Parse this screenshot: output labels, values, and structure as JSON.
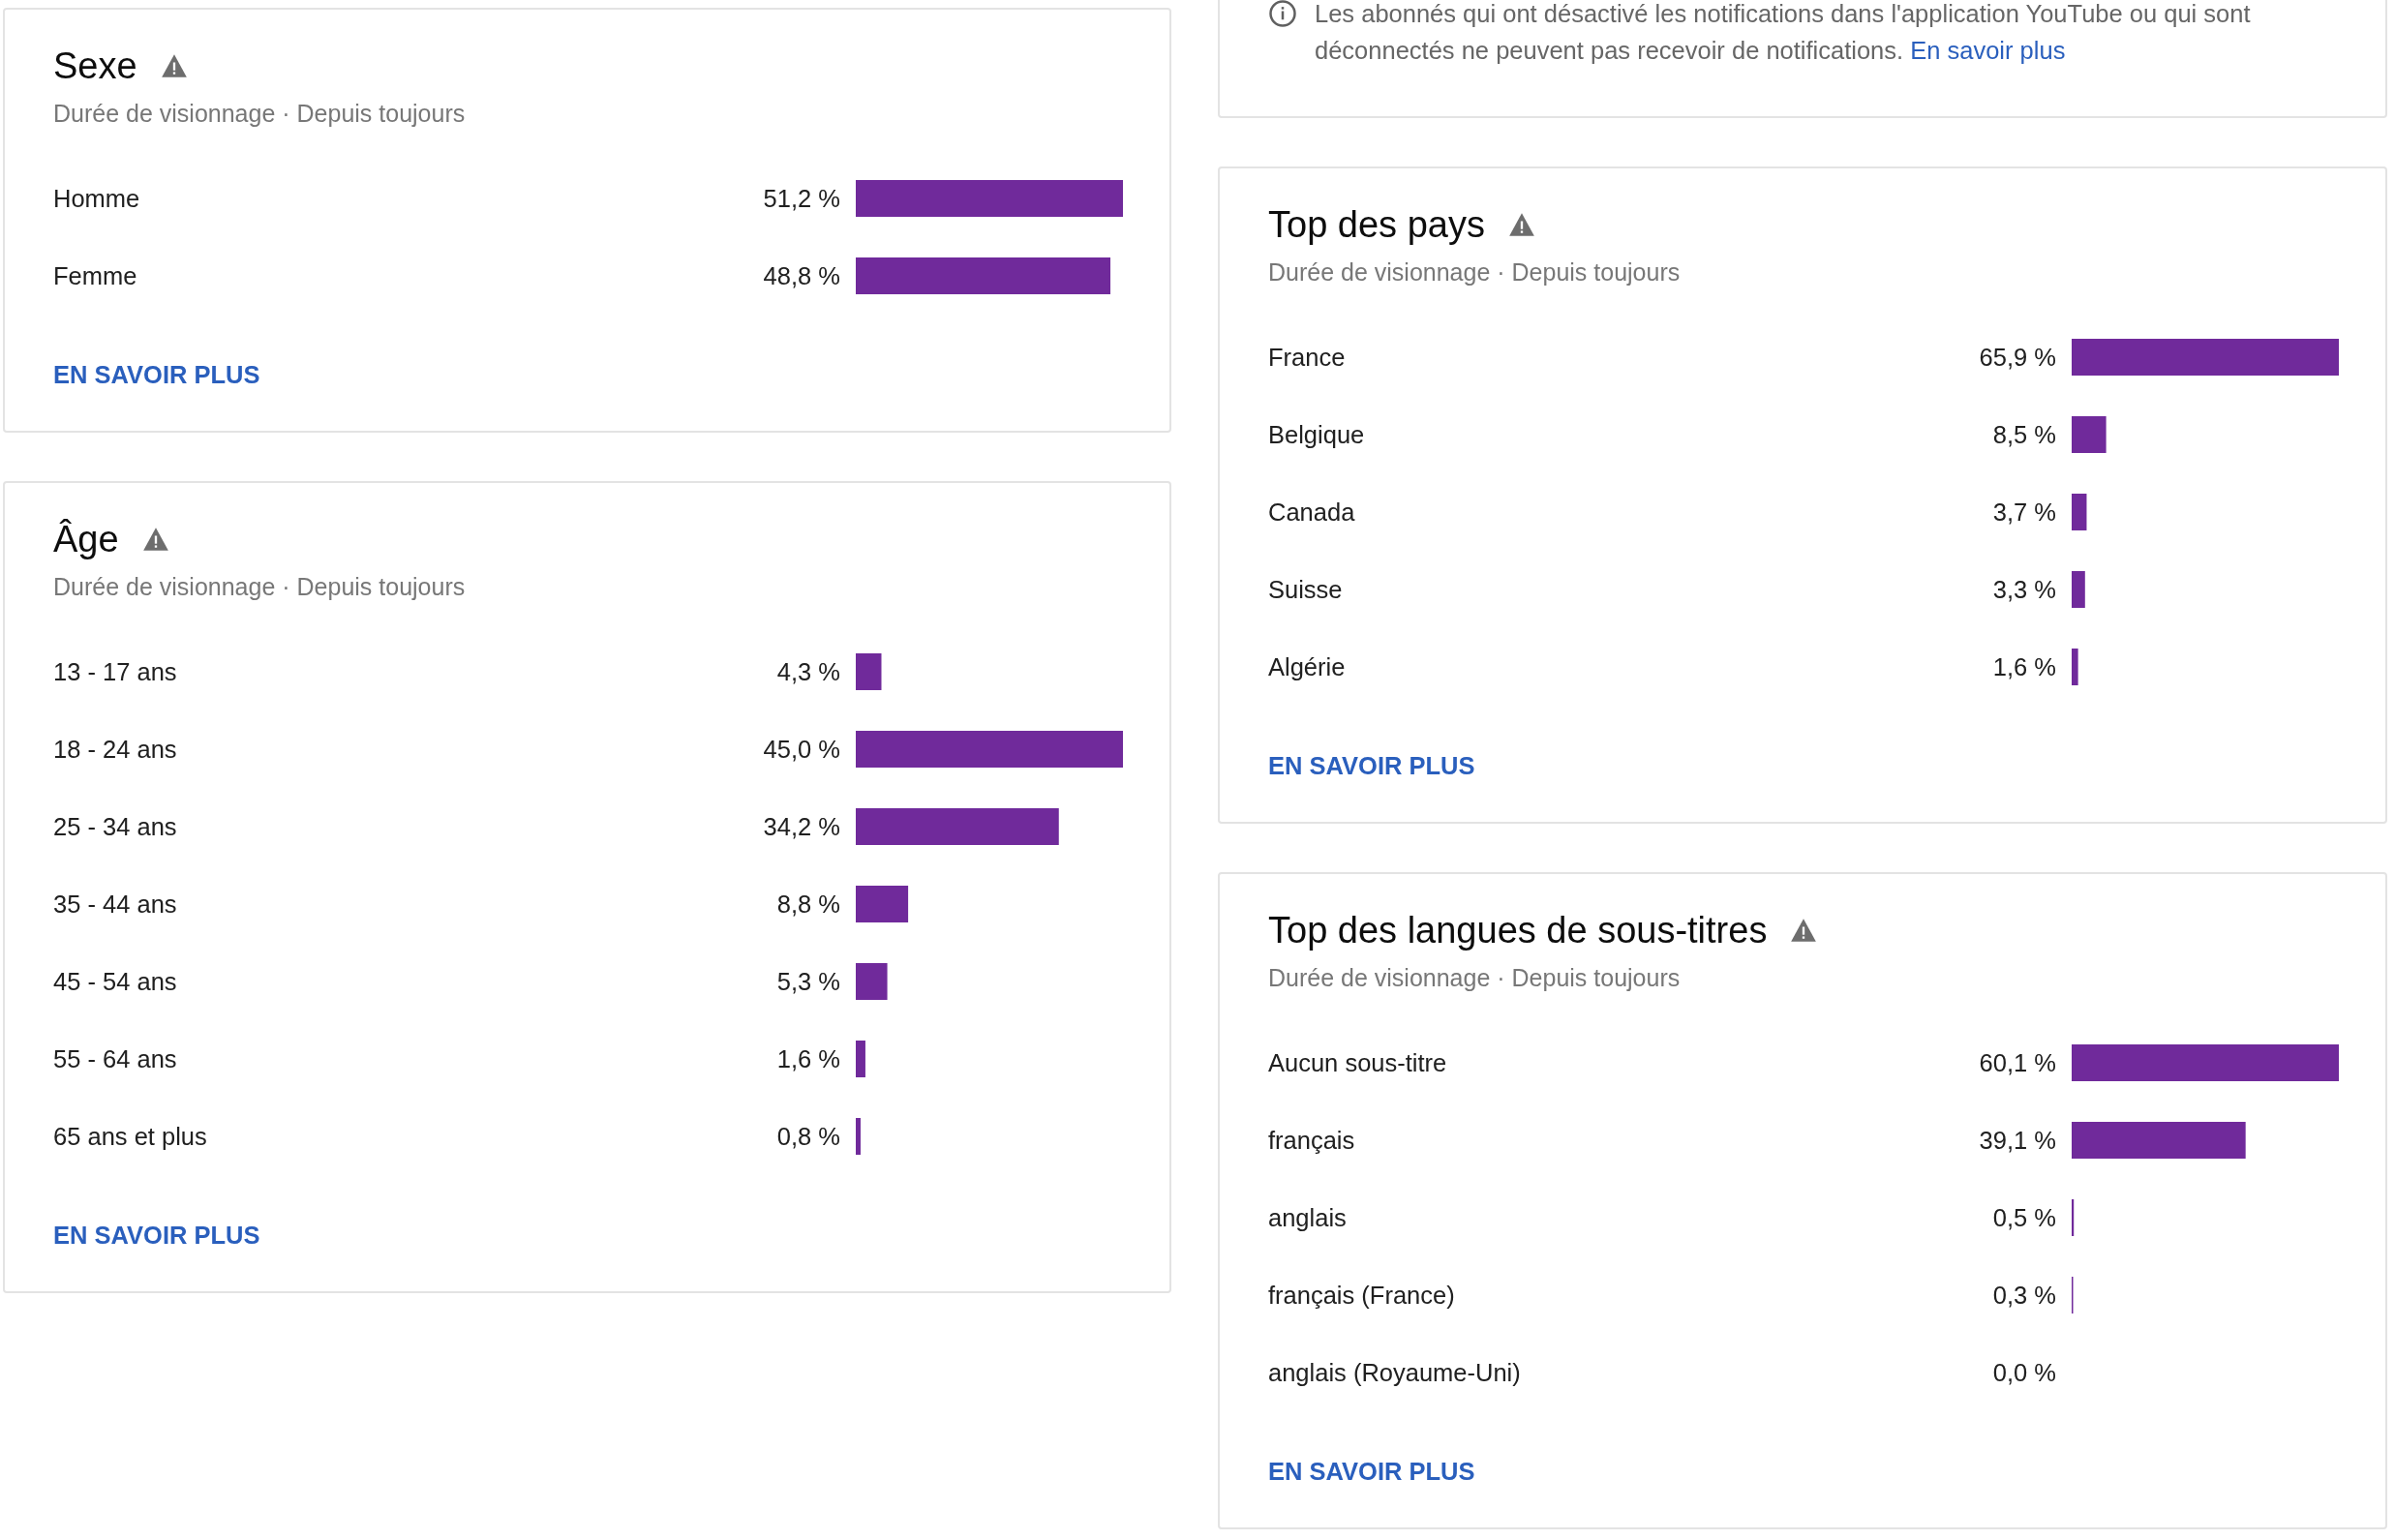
{
  "left_column": {
    "cards": [
      {
        "title": "Sexe",
        "subtitle": "Durée de visionnage · Depuis toujours",
        "rows": [
          {
            "label": "Homme",
            "value": "51,2 %",
            "level": 1
          },
          {
            "label": "Femme",
            "value": "48,8 %",
            "level": 0.953
          }
        ],
        "link": "EN SAVOIR PLUS"
      },
      {
        "title": "Âge",
        "subtitle": "Durée de visionnage · Depuis toujours",
        "rows": [
          {
            "label": "13 - 17 ans",
            "value": "4,3 %",
            "level": 0.096
          },
          {
            "label": "18 - 24 ans",
            "value": "45,0 %",
            "level": 1
          },
          {
            "label": "25 - 34 ans",
            "value": "34,2 %",
            "level": 0.76
          },
          {
            "label": "35 - 44 ans",
            "value": "8,8 %",
            "level": 0.196
          },
          {
            "label": "45 - 54 ans",
            "value": "5,3 %",
            "level": 0.118
          },
          {
            "label": "55 - 64 ans",
            "value": "1,6 %",
            "level": 0.036
          },
          {
            "label": "65 ans et plus",
            "value": "0,8 %",
            "level": 0.018
          }
        ],
        "link": "EN SAVOIR PLUS"
      }
    ]
  },
  "right_column": {
    "notice": {
      "text": "Les abonnés qui ont désactivé les notifications dans l'application YouTube ou qui sont déconnectés ne peuvent pas recevoir de notifications.",
      "link": "En savoir plus"
    },
    "cards": [
      {
        "title": "Top des pays",
        "subtitle": "Durée de visionnage · Depuis toujours",
        "rows": [
          {
            "label": "France",
            "value": "65,9 %",
            "level": 1
          },
          {
            "label": "Belgique",
            "value": "8,5 %",
            "level": 0.129
          },
          {
            "label": "Canada",
            "value": "3,7 %",
            "level": 0.056
          },
          {
            "label": "Suisse",
            "value": "3,3 %",
            "level": 0.05
          },
          {
            "label": "Algérie",
            "value": "1,6 %",
            "level": 0.024
          }
        ],
        "link": "EN SAVOIR PLUS"
      },
      {
        "title": "Top des langues de sous-titres",
        "subtitle": "Durée de visionnage · Depuis toujours",
        "rows": [
          {
            "label": "Aucun sous-titre",
            "value": "60,1 %",
            "level": 1
          },
          {
            "label": "français",
            "value": "39,1 %",
            "level": 0.651
          },
          {
            "label": "anglais",
            "value": "0,5 %",
            "level": 0.008
          },
          {
            "label": "français (France)",
            "value": "0,3 %",
            "level": 0.005
          },
          {
            "label": "anglais (Royaume-Uni)",
            "value": "0,0 %"
          }
        ],
        "link": "EN SAVOIR PLUS"
      }
    ]
  }
}
